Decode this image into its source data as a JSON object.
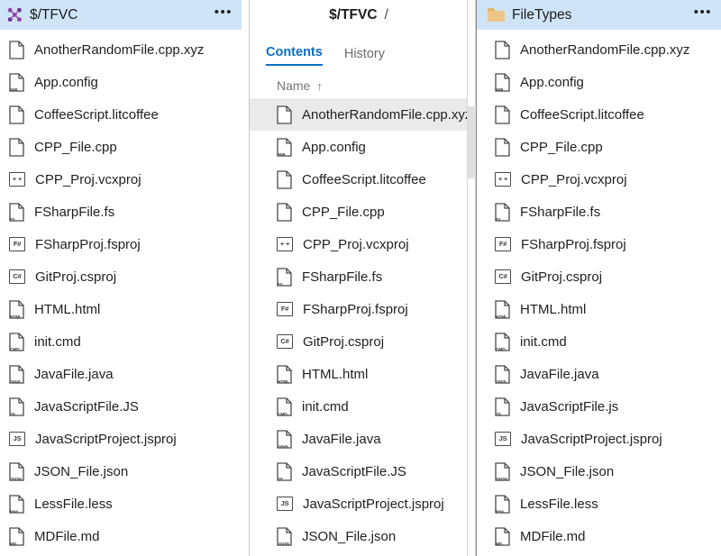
{
  "panels": {
    "left": {
      "header": {
        "icon": "tfvc-icon",
        "title": "$/TFVC",
        "menu_label": "•••"
      },
      "files": [
        {
          "name": "AnotherRandomFile.cpp.xyz",
          "icon": "file-blank-icon",
          "tag": "",
          "boxed": false
        },
        {
          "name": "App.config",
          "icon": "file-xml-icon",
          "tag": "XML",
          "boxed": false
        },
        {
          "name": "CoffeeScript.litcoffee",
          "icon": "file-coffee-icon",
          "tag": "",
          "boxed": false
        },
        {
          "name": "CPP_File.cpp",
          "icon": "file-cpp-icon",
          "tag": "",
          "boxed": false
        },
        {
          "name": "CPP_Proj.vcxproj",
          "icon": "proj-cpp-icon",
          "tag": "+ +",
          "boxed": true
        },
        {
          "name": "FSharpFile.fs",
          "icon": "file-fsharp-icon",
          "tag": "F#",
          "boxed": false
        },
        {
          "name": "FSharpProj.fsproj",
          "icon": "proj-fsharp-icon",
          "tag": "F#",
          "boxed": true
        },
        {
          "name": "GitProj.csproj",
          "icon": "proj-csharp-icon",
          "tag": "C#",
          "boxed": true
        },
        {
          "name": "HTML.html",
          "icon": "file-html-icon",
          "tag": "HTML",
          "boxed": false
        },
        {
          "name": "init.cmd",
          "icon": "file-cmd-icon",
          "tag": "CMD",
          "boxed": false
        },
        {
          "name": "JavaFile.java",
          "icon": "file-java-icon",
          "tag": "JAVA",
          "boxed": false
        },
        {
          "name": "JavaScriptFile.JS",
          "icon": "file-js-icon",
          "tag": "JS",
          "boxed": false
        },
        {
          "name": "JavaScriptProject.jsproj",
          "icon": "proj-js-icon",
          "tag": "JS",
          "boxed": true
        },
        {
          "name": "JSON_File.json",
          "icon": "file-json-icon",
          "tag": "JSON",
          "boxed": false
        },
        {
          "name": "LessFile.less",
          "icon": "file-less-icon",
          "tag": "less",
          "boxed": false
        },
        {
          "name": "MDFile.md",
          "icon": "file-md-icon",
          "tag": "MD",
          "boxed": false
        }
      ]
    },
    "middle": {
      "breadcrumb": {
        "root": "$/TFVC",
        "separator": "/"
      },
      "tabs": [
        {
          "label": "Contents",
          "active": true
        },
        {
          "label": "History",
          "active": false
        }
      ],
      "column_header": {
        "label": "Name",
        "sort_arrow": "↑"
      },
      "files": [
        {
          "name": "AnotherRandomFile.cpp.xyz",
          "icon": "file-blank-icon",
          "tag": "",
          "boxed": false,
          "selected": true
        },
        {
          "name": "App.config",
          "icon": "file-xml-icon",
          "tag": "XML",
          "boxed": false,
          "selected": false
        },
        {
          "name": "CoffeeScript.litcoffee",
          "icon": "file-coffee-icon",
          "tag": "",
          "boxed": false,
          "selected": false
        },
        {
          "name": "CPP_File.cpp",
          "icon": "file-cpp-icon",
          "tag": "",
          "boxed": false,
          "selected": false
        },
        {
          "name": "CPP_Proj.vcxproj",
          "icon": "proj-cpp-icon",
          "tag": "+ +",
          "boxed": true,
          "selected": false
        },
        {
          "name": "FSharpFile.fs",
          "icon": "file-fsharp-icon",
          "tag": "F#",
          "boxed": false,
          "selected": false
        },
        {
          "name": "FSharpProj.fsproj",
          "icon": "proj-fsharp-icon",
          "tag": "F#",
          "boxed": true,
          "selected": false
        },
        {
          "name": "GitProj.csproj",
          "icon": "proj-csharp-icon",
          "tag": "C#",
          "boxed": true,
          "selected": false
        },
        {
          "name": "HTML.html",
          "icon": "file-html-icon",
          "tag": "HTML",
          "boxed": false,
          "selected": false
        },
        {
          "name": "init.cmd",
          "icon": "file-cmd-icon",
          "tag": "CMD",
          "boxed": false,
          "selected": false
        },
        {
          "name": "JavaFile.java",
          "icon": "file-java-icon",
          "tag": "JAVA",
          "boxed": false,
          "selected": false
        },
        {
          "name": "JavaScriptFile.JS",
          "icon": "file-js-icon",
          "tag": "JS",
          "boxed": false,
          "selected": false
        },
        {
          "name": "JavaScriptProject.jsproj",
          "icon": "proj-js-icon",
          "tag": "JS",
          "boxed": true,
          "selected": false
        },
        {
          "name": "JSON_File.json",
          "icon": "file-json-icon",
          "tag": "JSON",
          "boxed": false,
          "selected": false
        }
      ]
    },
    "right": {
      "header": {
        "icon": "folder-icon",
        "title": "FileTypes",
        "menu_label": "•••"
      },
      "files": [
        {
          "name": "AnotherRandomFile.cpp.xyz",
          "icon": "file-blank-icon",
          "tag": "",
          "boxed": false
        },
        {
          "name": "App.config",
          "icon": "file-xml-icon",
          "tag": "XML",
          "boxed": false
        },
        {
          "name": "CoffeeScript.litcoffee",
          "icon": "file-coffee-icon",
          "tag": "",
          "boxed": false
        },
        {
          "name": "CPP_File.cpp",
          "icon": "file-cpp-icon",
          "tag": "",
          "boxed": false
        },
        {
          "name": "CPP_Proj.vcxproj",
          "icon": "proj-cpp-icon",
          "tag": "+ +",
          "boxed": true
        },
        {
          "name": "FSharpFile.fs",
          "icon": "file-fsharp-icon",
          "tag": "F#",
          "boxed": false
        },
        {
          "name": "FSharpProj.fsproj",
          "icon": "proj-fsharp-icon",
          "tag": "F#",
          "boxed": true
        },
        {
          "name": "GitProj.csproj",
          "icon": "proj-csharp-icon",
          "tag": "C#",
          "boxed": true
        },
        {
          "name": "HTML.html",
          "icon": "file-html-icon",
          "tag": "HTML",
          "boxed": false
        },
        {
          "name": "init.cmd",
          "icon": "file-cmd-icon",
          "tag": "CMD",
          "boxed": false
        },
        {
          "name": "JavaFile.java",
          "icon": "file-java-icon",
          "tag": "JAVA",
          "boxed": false
        },
        {
          "name": "JavaScriptFile.js",
          "icon": "file-js-icon",
          "tag": "JS",
          "boxed": false
        },
        {
          "name": "JavaScriptProject.jsproj",
          "icon": "proj-js-icon",
          "tag": "JS",
          "boxed": true
        },
        {
          "name": "JSON_File.json",
          "icon": "file-json-icon",
          "tag": "JSON",
          "boxed": false
        },
        {
          "name": "LessFile.less",
          "icon": "file-less-icon",
          "tag": "less",
          "boxed": false
        },
        {
          "name": "MDFile.md",
          "icon": "file-md-icon",
          "tag": "MD",
          "boxed": false
        }
      ]
    }
  },
  "colors": {
    "header_bg": "#cfe4f7",
    "selected_row_bg": "#eaeaea",
    "accent_blue": "#0c6ec4",
    "tfvc_purple": "#68217a",
    "folder_tan": "#eec588",
    "text": "#1f1f1f",
    "muted_text": "#767676"
  }
}
